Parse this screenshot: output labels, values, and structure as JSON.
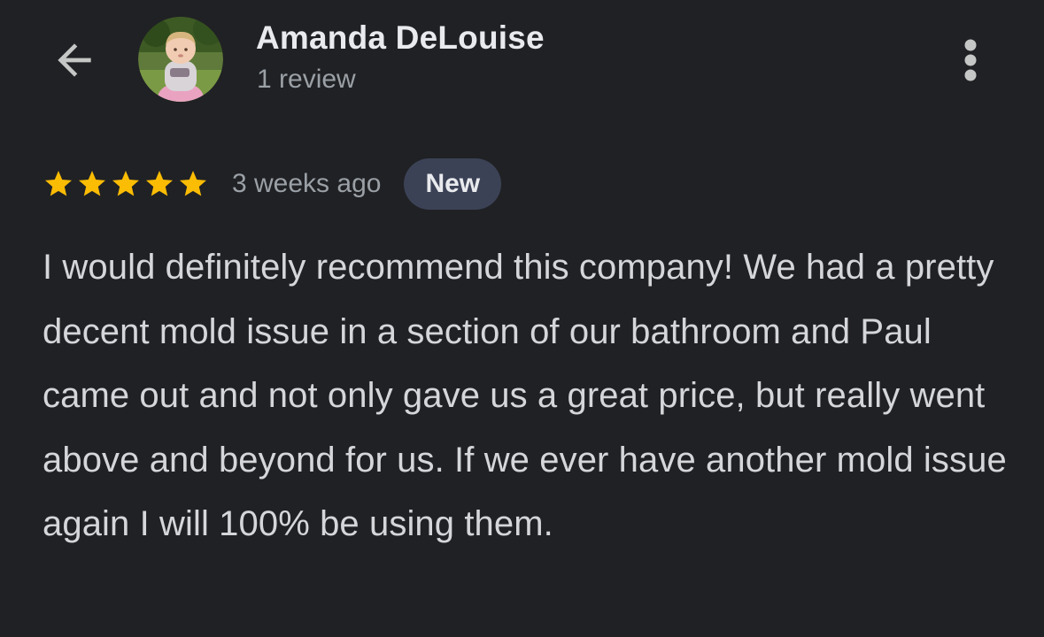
{
  "header": {
    "back_icon": "arrow-back-icon",
    "avatar_icon": "reviewer-avatar-photo",
    "reviewer_name": "Amanda DeLouise",
    "review_count": "1 review",
    "more_icon": "more-vertical-icon"
  },
  "review": {
    "rating": 5,
    "rating_max": 5,
    "star_color": "#fbbc04",
    "time_ago": "3 weeks ago",
    "badge": "New",
    "text": "I would definitely recommend this company! We had a pretty decent mold issue in a section of our bathroom and Paul came out and not only gave us a great price, but really went above and beyond for us. If we ever have another mold issue again I will 100% be using them."
  }
}
